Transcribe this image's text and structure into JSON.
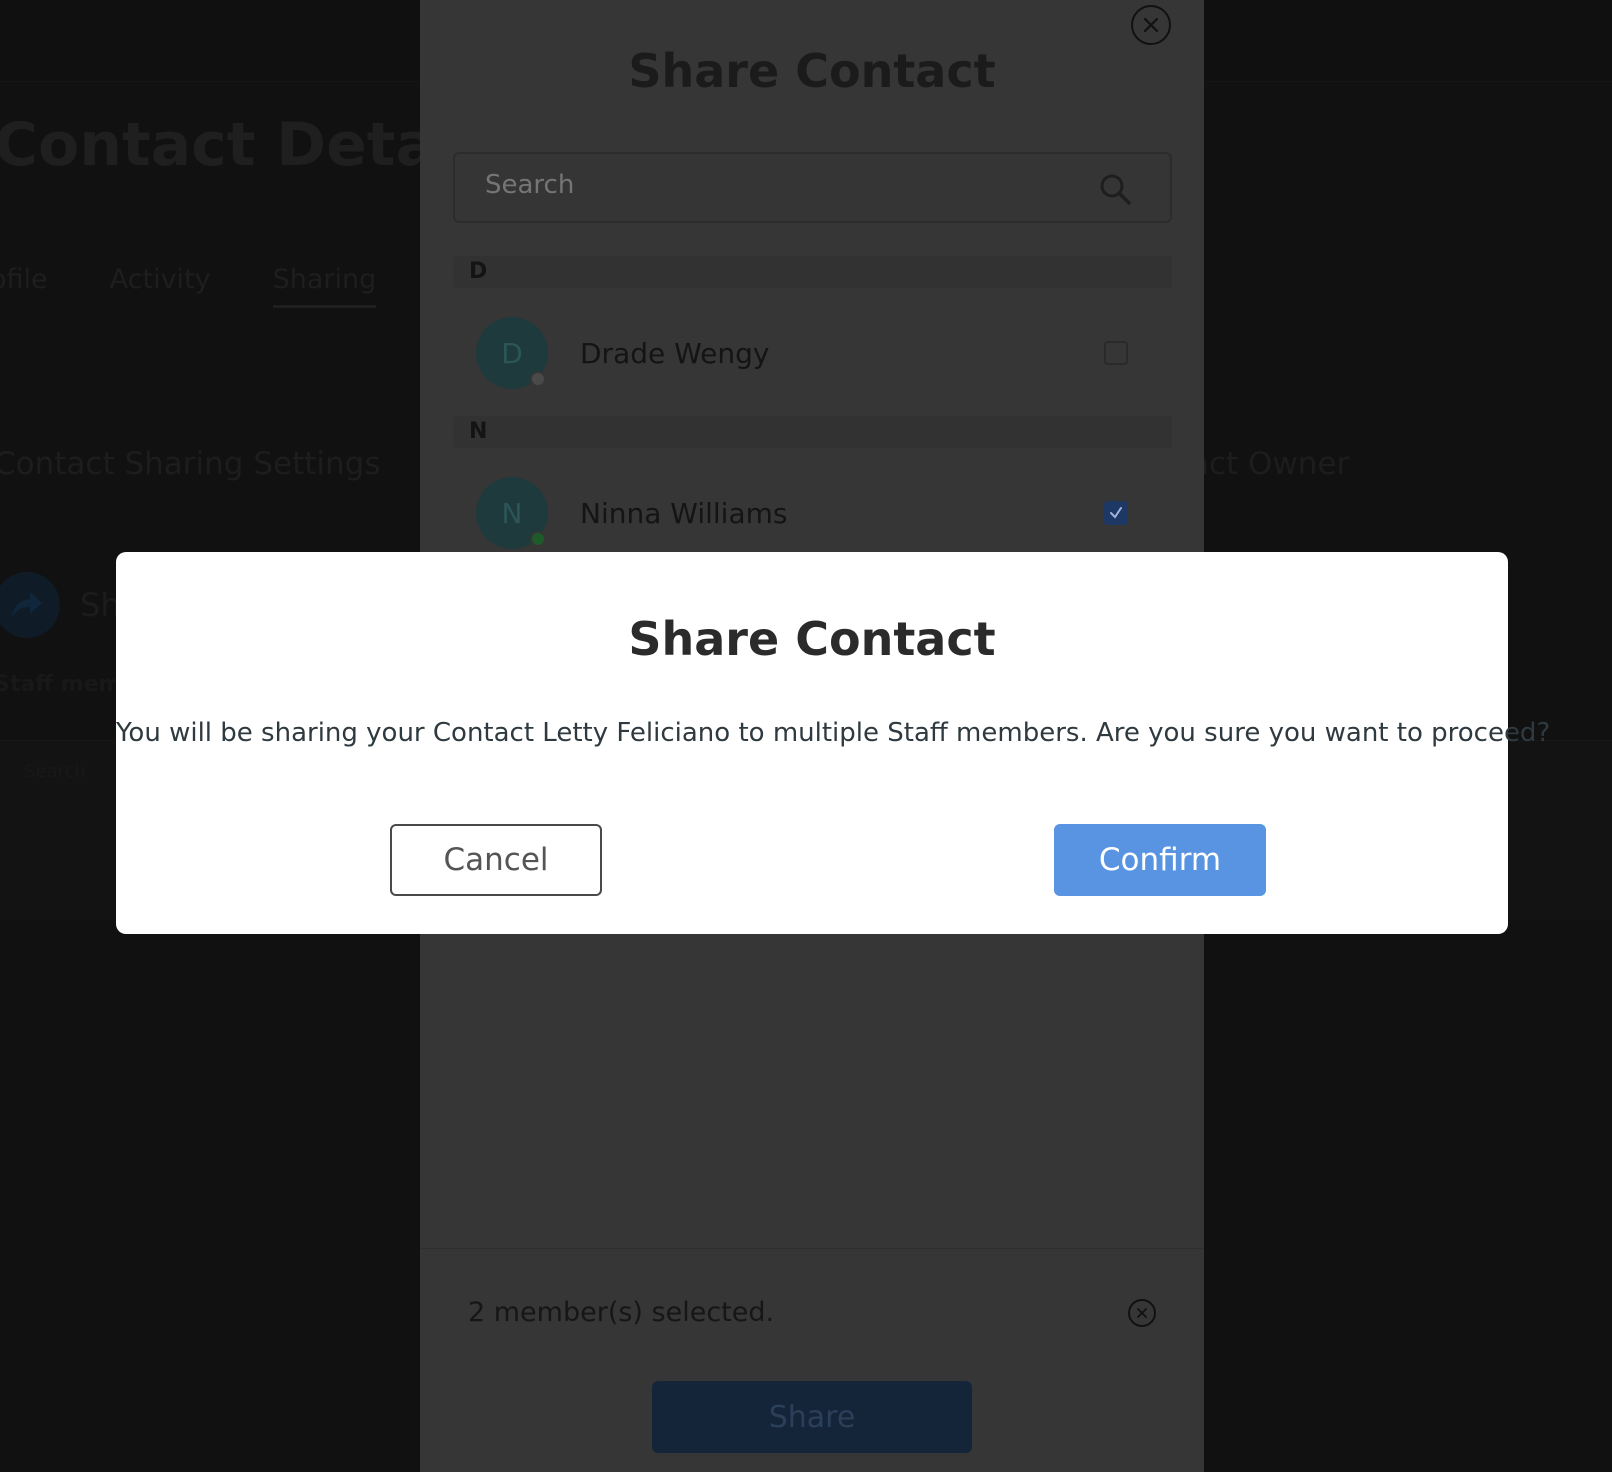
{
  "background": {
    "page_title": "Contact Details",
    "tabs": [
      {
        "label": "ofile"
      },
      {
        "label": "Activity"
      },
      {
        "label": "Sharing",
        "active": true
      }
    ],
    "section_title": "Contact Sharing Settings",
    "owner_title": "act Owner",
    "share_row_text": "Sh",
    "staff_label": "Staff memb",
    "table_cell": "Search"
  },
  "share_panel": {
    "title": "Share Contact",
    "search_placeholder": "Search",
    "groups": [
      {
        "letter": "D",
        "contacts": [
          {
            "initial": "D",
            "name": "Drade Wengy",
            "checked": false,
            "status_color": "#4a4a4a"
          }
        ]
      },
      {
        "letter": "N",
        "contacts": [
          {
            "initial": "N",
            "name": "Ninna Williams",
            "checked": true,
            "status_color": "#1f5a2a"
          }
        ]
      }
    ],
    "selected_text": "2 member(s) selected.",
    "share_button": "Share"
  },
  "confirm_modal": {
    "title": "Share Contact",
    "message": "You will be sharing your Contact Letty Feliciano to multiple Staff members. Are you sure you want to proceed?",
    "cancel_label": "Cancel",
    "confirm_label": "Confirm",
    "confirm_color": "#5894e2"
  },
  "icons": {
    "close": "close-icon",
    "search": "search-icon",
    "share": "share-arrow-icon",
    "check": "checkmark-icon"
  }
}
